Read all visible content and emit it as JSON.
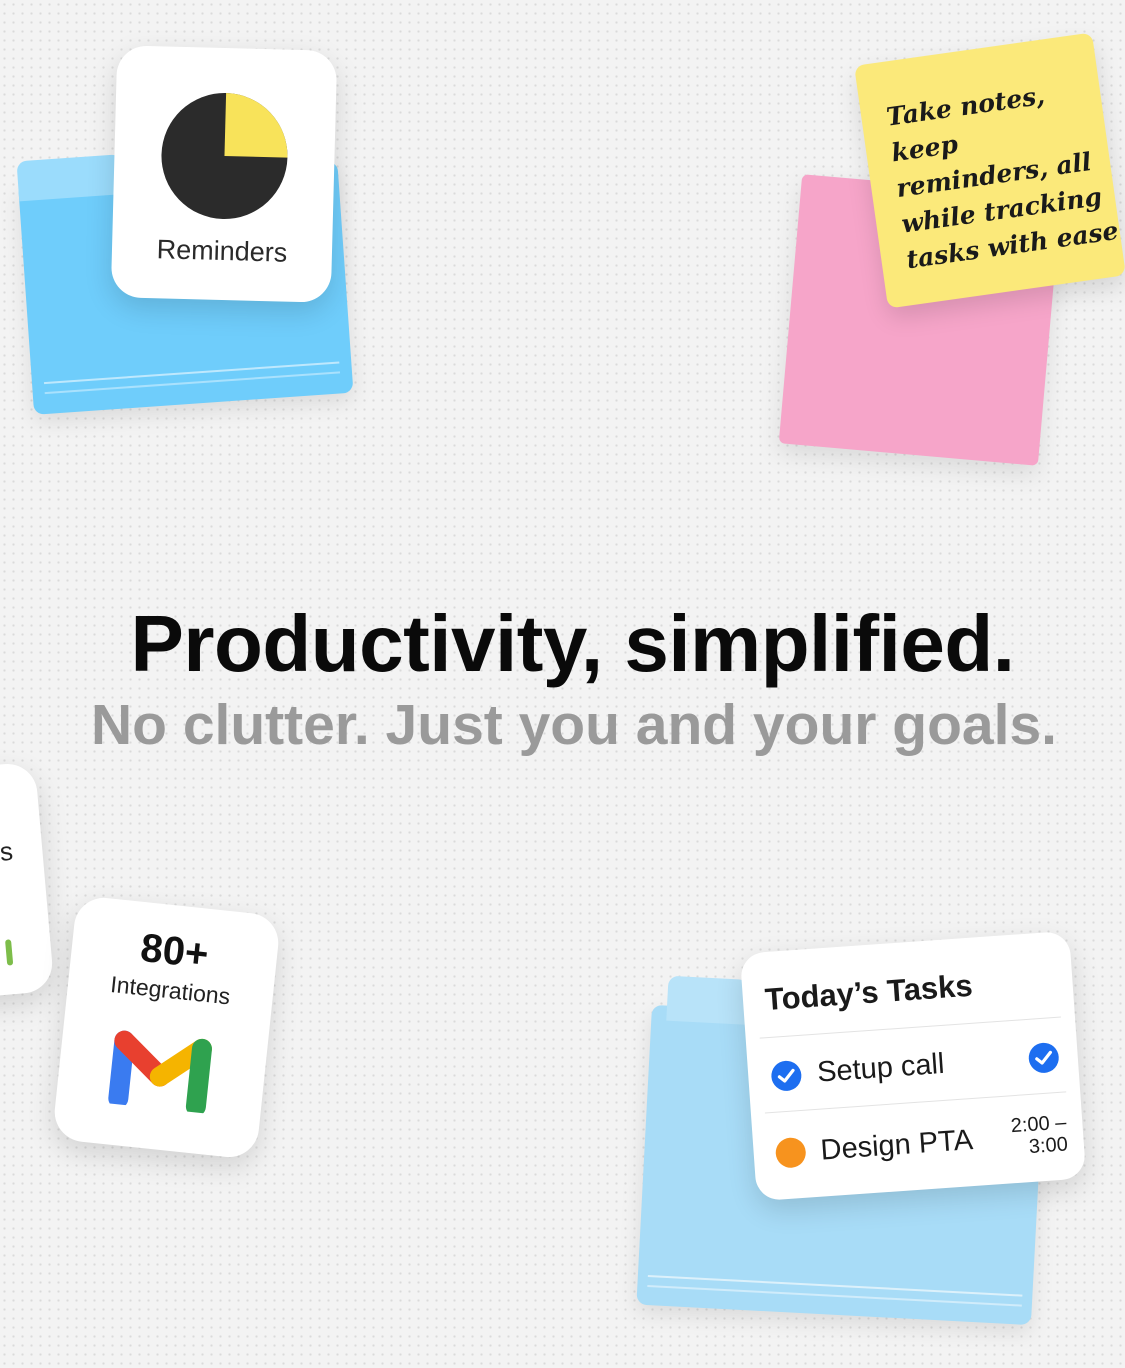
{
  "reminders_widget": {
    "label": "Reminders",
    "pie_filled_fraction": 0.25
  },
  "sticky_note": {
    "text": "Take notes, keep\nreminders, all\nwhile tracking\ntasks with ease"
  },
  "hero": {
    "title": "Productivity, simplified.",
    "subtitle": "No clutter. Just you and your goals."
  },
  "partial_card": {
    "visible_text": "ns"
  },
  "integrations_card": {
    "count": "80+",
    "label": "Integrations",
    "logo": "gmail-logo-icon"
  },
  "tasks_card": {
    "title": "Today’s Tasks",
    "tasks": [
      {
        "label": "Setup call",
        "status": "done",
        "time_start": "",
        "time_end": ""
      },
      {
        "label": "Design PTA",
        "status": "scheduled",
        "time_start": "2:00 –",
        "time_end": "3:00"
      }
    ]
  },
  "colors": {
    "folder_blue": "#6fcdfb",
    "folder_blue_light": "#a8dcf7",
    "sticky_yellow": "#fbe97a",
    "sticky_pink": "#f6a5c9",
    "pie_yellow": "#f8e35a",
    "pie_dark": "#2b2b2b",
    "check_blue": "#1d6ef0",
    "dot_orange": "#f7931e"
  }
}
